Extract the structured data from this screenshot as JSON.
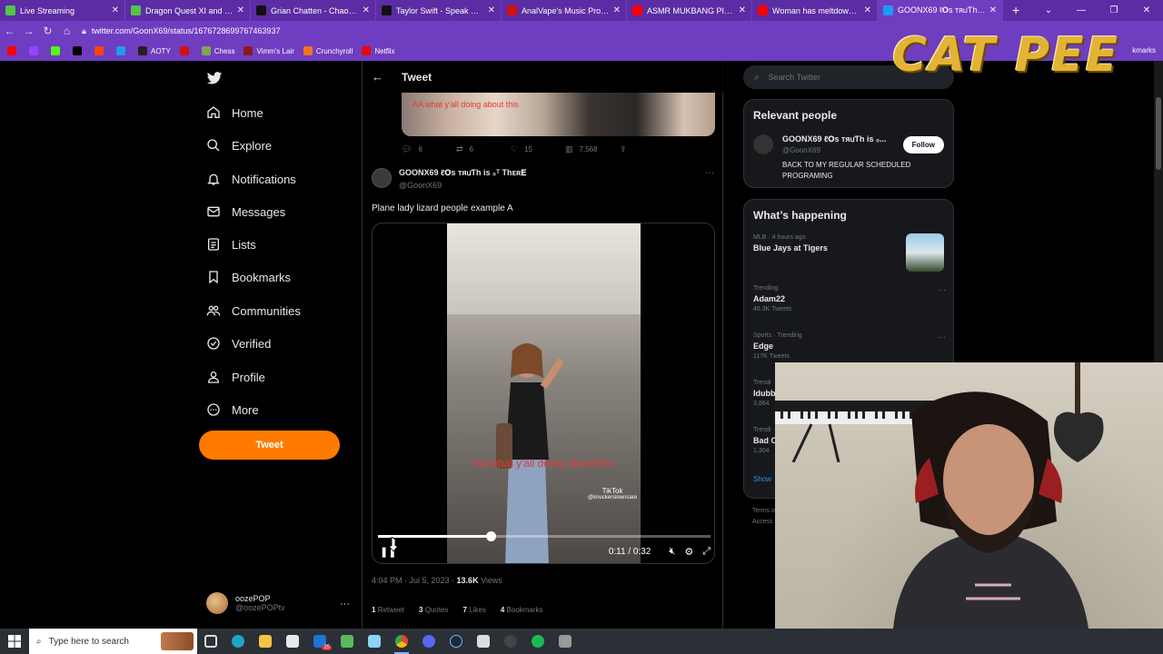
{
  "browser": {
    "tabs": [
      {
        "title": "Live Streaming",
        "icon": "play-icon",
        "color": "#53c44a"
      },
      {
        "title": "Dragon Quest XI and rand",
        "icon": "play-icon",
        "color": "#53c44a"
      },
      {
        "title": "Grian Chatten - Chaos for",
        "icon": "aoty-icon",
        "color": "#000000"
      },
      {
        "title": "Taylor Swift - Speak Now (",
        "icon": "aoty-icon",
        "color": "#000000"
      },
      {
        "title": "AnalVape's Music Profile |",
        "icon": "lastfm-icon",
        "color": "#d51007"
      },
      {
        "title": "ASMR MUKBANG PITBULL",
        "icon": "youtube-icon",
        "color": "#ff0000"
      },
      {
        "title": "Woman has meltdown ove",
        "icon": "youtube-icon",
        "color": "#ff0000"
      },
      {
        "title": "GOONX69 ℓ𝐎ѕ тяᥙƬh is ₀",
        "icon": "twitter-icon",
        "color": "#1d9bf0"
      }
    ],
    "url": "twitter.com/GoonX69/status/1676728699767463937",
    "bookmarks": [
      {
        "label": "",
        "color": "#ff0000"
      },
      {
        "label": "",
        "color": "#9146ff"
      },
      {
        "label": "",
        "color": "#53fc18"
      },
      {
        "label": "",
        "color": "#000000"
      },
      {
        "label": "",
        "color": "#ff4500"
      },
      {
        "label": "",
        "color": "#1d9bf0"
      },
      {
        "label": "AOTY",
        "color": "#222222"
      },
      {
        "label": "",
        "color": "#d51007"
      },
      {
        "label": "Chess",
        "color": "#7fa650"
      },
      {
        "label": "Vimm's Lair",
        "color": "#8b1a1a"
      },
      {
        "label": "Crunchyroll",
        "color": "#f47521"
      },
      {
        "label": "Netflix",
        "color": "#e50914"
      }
    ],
    "bookmarks_overflow": "kmarks"
  },
  "nav": {
    "items": [
      "Home",
      "Explore",
      "Notifications",
      "Messages",
      "Lists",
      "Bookmarks",
      "Communities",
      "Verified",
      "Profile",
      "More"
    ],
    "tweet_button": "Tweet",
    "user_name": "oozePOP",
    "user_handle": "@oozePOPtv"
  },
  "main": {
    "header_title": "Tweet",
    "quote_caption": "AA what y'all doing about this",
    "actions": {
      "replies": "6",
      "retweets": "6",
      "likes": "15",
      "views": "7,568"
    },
    "tweet": {
      "display_name": "GOONX69 ℓ𝐎ѕ тяᥙƬh is ₀ᵀ Thᴇʀ𝐄",
      "handle": "@GoonX69",
      "text": "Plane lady lizard people example A",
      "video_caption": "AA what y'all doing about this",
      "tiktok_label": "TikTok",
      "tiktok_handle": "@knuckerslowncare",
      "time_display": "0:11 / 0:32",
      "progress": 0.34,
      "posted": "4:04 PM · Jul 5, 2023 · ",
      "views_count": "13.6K",
      "views_label": " Views",
      "retweets": "1",
      "retweets_label": " Retweet",
      "quotes": "3",
      "quotes_label": " Quotes",
      "likes": "7",
      "likes_label": " Likes",
      "bookmarks": "4",
      "bookmarks_label": " Bookmarks"
    }
  },
  "right": {
    "search_placeholder": "Search Twitter",
    "relevant_title": "Relevant people",
    "relevant": {
      "display_name": "GOONX69 ℓ𝐎ѕ тяᥙƬh is ₀...",
      "handle": "@GoonX69",
      "bio": "BACK TO MY REGULAR SCHEDULED PROGRAMING",
      "follow_label": "Follow"
    },
    "happening_title": "What’s happening",
    "trends": [
      {
        "context": "MLB · 4 hours ago",
        "name": "Blue Jays at Tigers",
        "count": ""
      },
      {
        "context": "Trending",
        "name": "Adam22",
        "count": "46.3K Tweets"
      },
      {
        "context": "Sports · Trending",
        "name": "Edge",
        "count": "117K Tweets"
      },
      {
        "context": "Trendi",
        "name": "Idubb",
        "count": "3,864"
      },
      {
        "context": "Trendi",
        "name": "Bad C",
        "count": "1,304"
      }
    ],
    "show_more": "Show",
    "footer": [
      "Terms o",
      "Access"
    ]
  },
  "overlay": {
    "logo_text": "CAT PEE"
  },
  "taskbar": {
    "search_placeholder": "Type here to search",
    "mail_badge": "25"
  }
}
